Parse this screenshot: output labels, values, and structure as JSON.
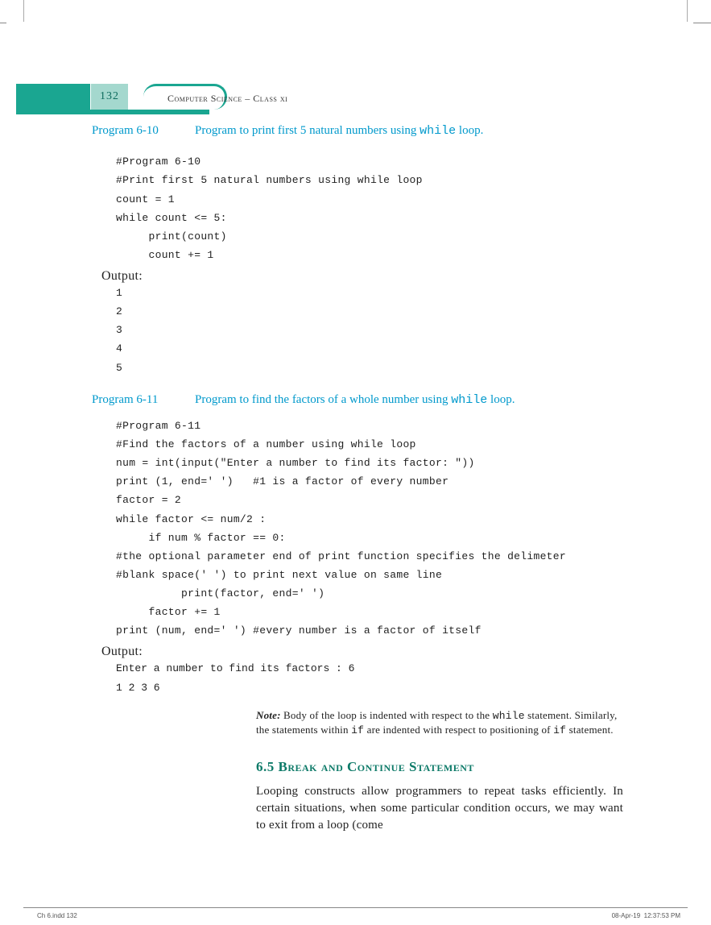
{
  "header": {
    "page_number": "132",
    "book_title": "Computer Science – Class xi"
  },
  "prog610": {
    "num": "Program 6-10",
    "desc_pre": "Program to print first 5 natural numbers using ",
    "desc_mono": "while",
    "desc_post": " loop.",
    "code": "#Program 6-10\n#Print first 5 natural numbers using while loop\ncount = 1\nwhile count <= 5:\n     print(count)\n     count += 1",
    "output_label": "Output:",
    "output": "1\n2\n3\n4\n5"
  },
  "prog611": {
    "num": "Program 6-11",
    "desc_pre": "Program to find the factors of a whole number  using ",
    "desc_mono": "while",
    "desc_post": " loop.",
    "code": "#Program 6-11\n#Find the factors of a number using while loop\nnum = int(input(\"Enter a number to find its factor: \"))\nprint (1, end=' ')   #1 is a factor of every number\nfactor = 2\nwhile factor <= num/2 :\n     if num % factor == 0:\n#the optional parameter end of print function specifies the delimeter\n#blank space(' ') to print next value on same line\n          print(factor, end=' ')\n     factor += 1\nprint (num, end=' ') #every number is a factor of itself",
    "output_label": "Output:",
    "output": "Enter a number to find its factors : 6\n1 2 3 6"
  },
  "note": {
    "bold": "Note:",
    "t1": " Body of the loop is indented with respect to the ",
    "m1": "while",
    "t2": " statement. Similarly, the statements within ",
    "m2": "if",
    "t3": " are indented with respect to positioning of ",
    "m3": "if",
    "t4": " statement."
  },
  "section": {
    "num": "6.5",
    "title": "Break and Continue Statement"
  },
  "para": "Looping constructs allow programmers to repeat tasks efficiently. In certain situations, when some particular condition occurs, we may want to exit from a loop (come",
  "footer": {
    "left": "Ch 6.indd   132",
    "date": "08-Apr-19",
    "time": "12:37:53 PM"
  }
}
